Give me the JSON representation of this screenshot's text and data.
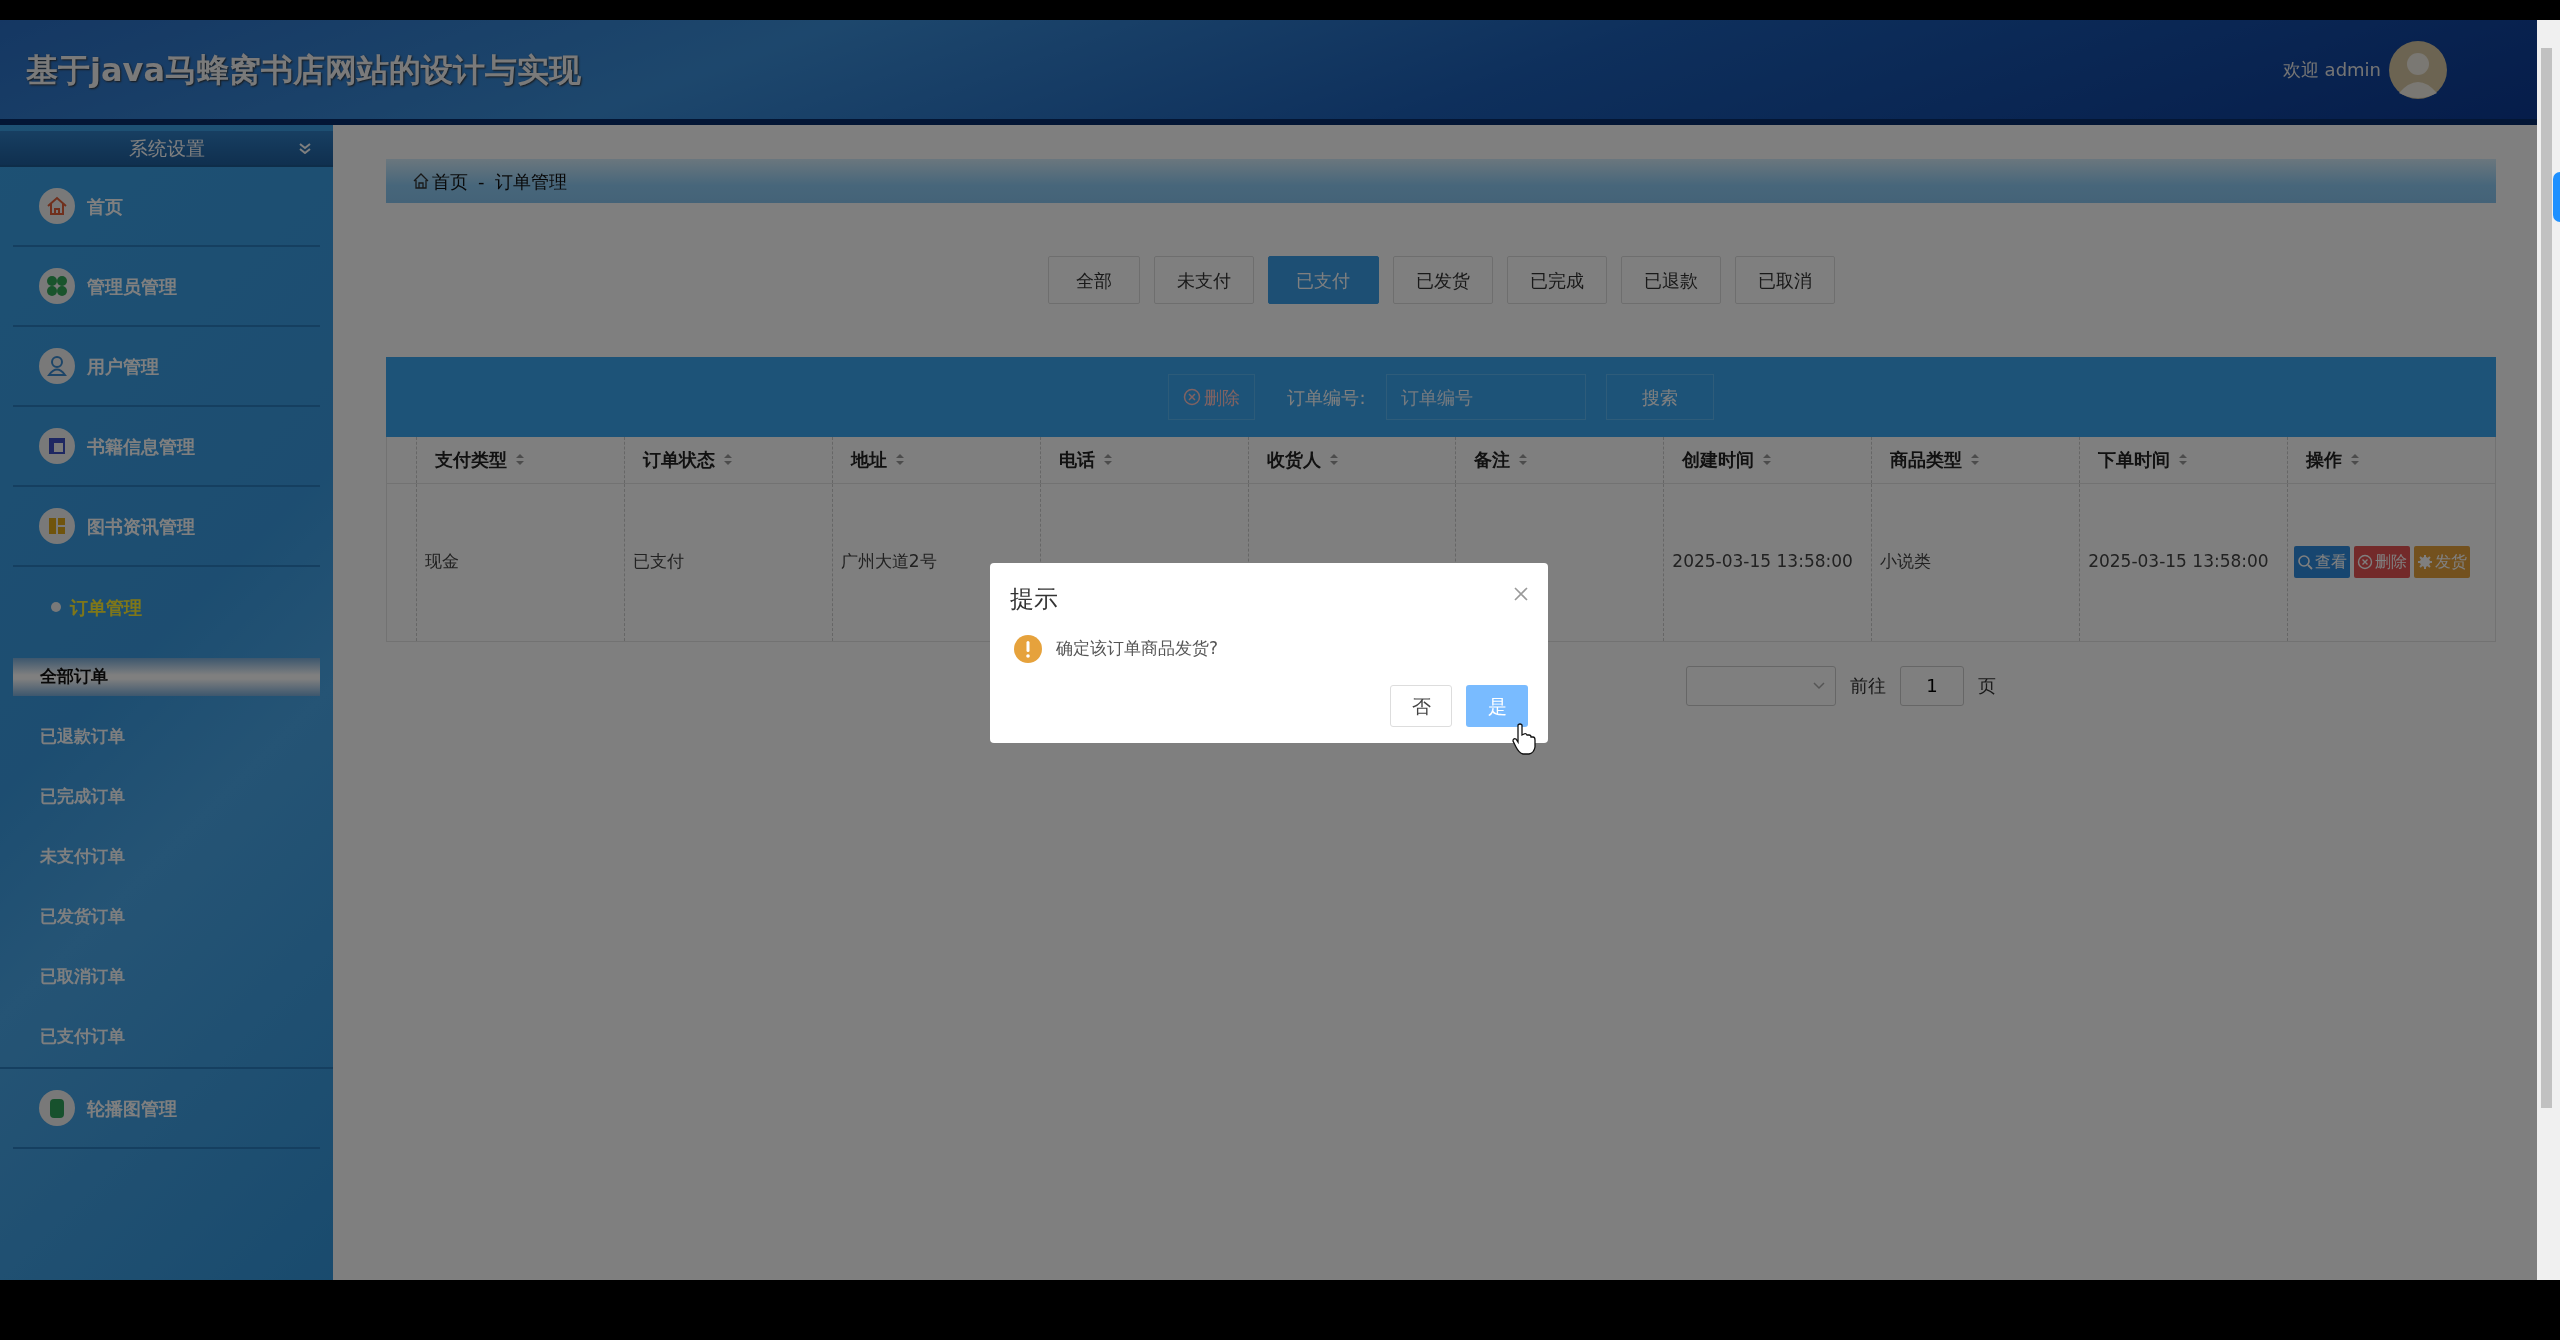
{
  "header": {
    "title": "基于java马蜂窝书店网站的设计与实现",
    "welcome": "欢迎 admin"
  },
  "sidebar": {
    "section_title": "系统设置",
    "items": [
      {
        "label": "首页",
        "kind": "home",
        "selected": false
      },
      {
        "label": "管理员管理",
        "kind": "clover",
        "selected": false
      },
      {
        "label": "用户管理",
        "kind": "user",
        "selected": false
      },
      {
        "label": "书籍信息管理",
        "kind": "layout",
        "selected": false
      },
      {
        "label": "图书资讯管理",
        "kind": "grid",
        "selected": false
      },
      {
        "label": "订单管理",
        "kind": "dot",
        "selected": true,
        "children": [
          {
            "label": "全部订单",
            "selected": true
          },
          {
            "label": "已退款订单",
            "selected": false
          },
          {
            "label": "已完成订单",
            "selected": false
          },
          {
            "label": "未支付订单",
            "selected": false
          },
          {
            "label": "已发货订单",
            "selected": false
          },
          {
            "label": "已取消订单",
            "selected": false
          },
          {
            "label": "已支付订单",
            "selected": false
          }
        ]
      },
      {
        "label": "轮播图管理",
        "kind": "phone",
        "selected": false
      }
    ]
  },
  "breadcrumb": {
    "items": [
      "首页",
      "订单管理"
    ],
    "separator": "-"
  },
  "status_tabs": [
    {
      "label": "全部",
      "selected": false
    },
    {
      "label": "未支付",
      "selected": false
    },
    {
      "label": "已支付",
      "selected": true
    },
    {
      "label": "已发货",
      "selected": false
    },
    {
      "label": "已完成",
      "selected": false
    },
    {
      "label": "已退款",
      "selected": false
    },
    {
      "label": "已取消",
      "selected": false
    }
  ],
  "toolbar": {
    "delete_button": "删除",
    "search_label": "订单编号:",
    "search_placeholder": "订单编号",
    "search_button": "搜索"
  },
  "table": {
    "columns": [
      "支付类型",
      "订单状态",
      "地址",
      "电话",
      "收货人",
      "备注",
      "创建时间",
      "商品类型",
      "下单时间",
      "操作"
    ],
    "rows": [
      {
        "payment_type": "现金",
        "status": "已支付",
        "address": "广州大道2号",
        "created_at": "2025-03-15 13:58:00",
        "category": "小说类",
        "ordered_at": "2025-03-15 13:58:00",
        "actions": [
          {
            "kind": "view",
            "label": "查看"
          },
          {
            "kind": "delete",
            "label": "删除"
          },
          {
            "kind": "ship",
            "label": "发货"
          }
        ]
      }
    ]
  },
  "pagination": {
    "goto_label": "前往",
    "page": "1",
    "page_suffix": "页"
  },
  "dialog": {
    "title": "提示",
    "message": "确定该订单商品发货?",
    "cancel_button": "否",
    "confirm_button": "是"
  }
}
